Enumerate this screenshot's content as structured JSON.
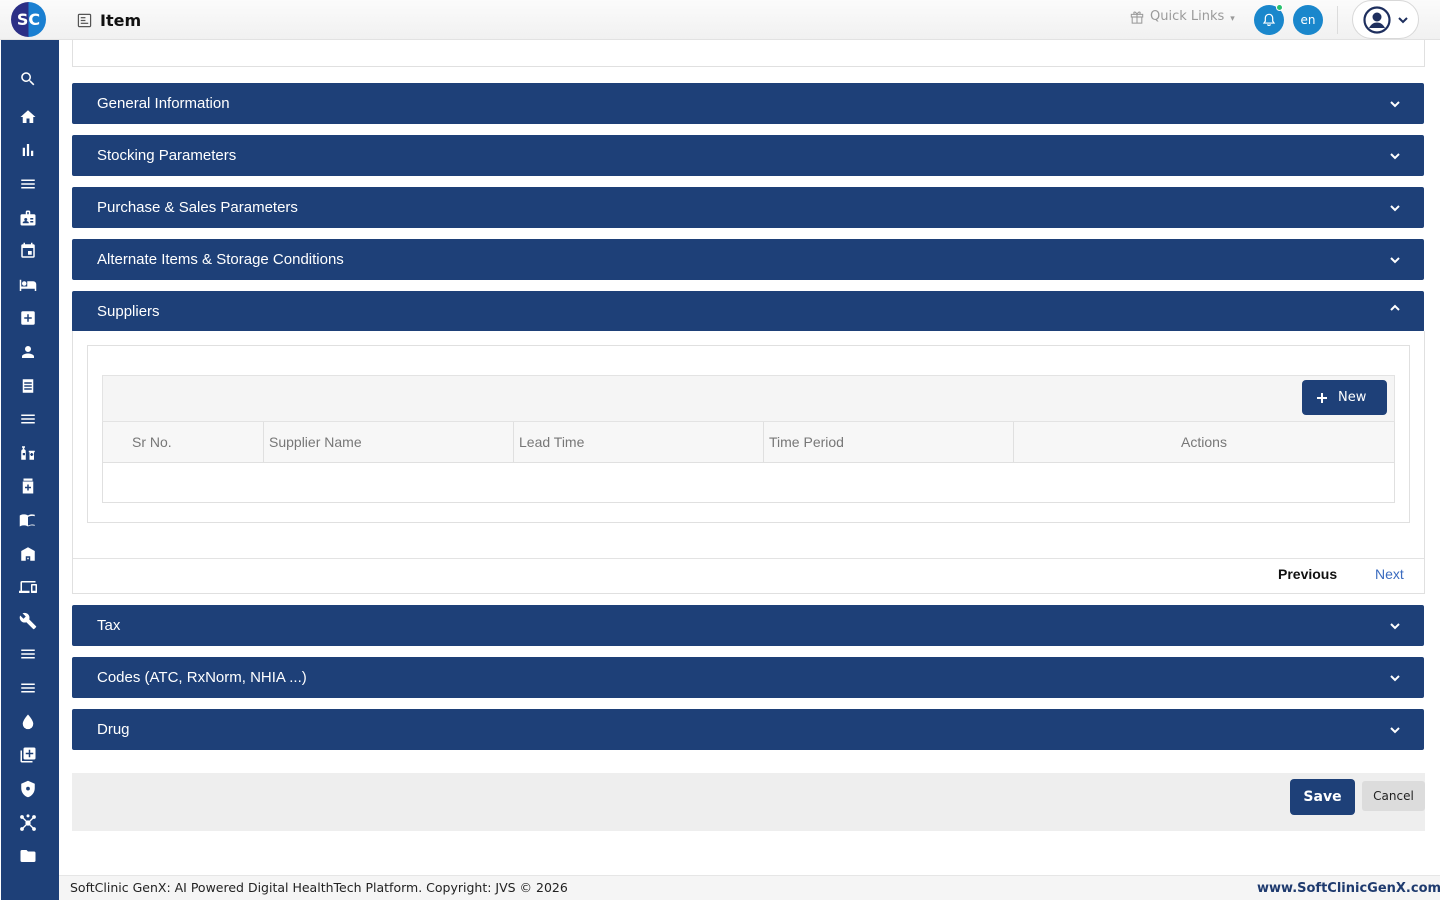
{
  "app": {
    "logo_text": "SC",
    "page_title": "Item"
  },
  "header": {
    "quick_links_label": "Quick Links",
    "language": "en",
    "accent_color": "#1a87cc"
  },
  "sidebar": {
    "items": [
      {
        "icon": "search-icon"
      },
      {
        "icon": "home-icon"
      },
      {
        "icon": "bar-chart-icon"
      },
      {
        "icon": "menu-icon"
      },
      {
        "icon": "id-badge-icon"
      },
      {
        "icon": "calendar-icon"
      },
      {
        "icon": "bed-icon"
      },
      {
        "icon": "medical-plus-icon"
      },
      {
        "icon": "person-icon"
      },
      {
        "icon": "document-list-icon"
      },
      {
        "icon": "menu-icon"
      },
      {
        "icon": "pharmacy-icon"
      },
      {
        "icon": "medicine-box-icon"
      },
      {
        "icon": "book-icon"
      },
      {
        "icon": "store-icon"
      },
      {
        "icon": "devices-icon"
      },
      {
        "icon": "wrench-icon"
      },
      {
        "icon": "menu-icon"
      },
      {
        "icon": "menu-icon"
      },
      {
        "icon": "blood-drop-icon"
      },
      {
        "icon": "add-box-icon"
      },
      {
        "icon": "shield-icon"
      },
      {
        "icon": "hub-icon"
      },
      {
        "icon": "folder-icon"
      }
    ]
  },
  "sections": {
    "general": "General Information",
    "stocking": "Stocking Parameters",
    "purchase_sales": "Purchase & Sales Parameters",
    "alternate": "Alternate Items & Storage Conditions",
    "suppliers": "Suppliers",
    "tax": "Tax",
    "codes": "Codes (ATC, RxNorm, NHIA ...)",
    "drug": "Drug"
  },
  "suppliers": {
    "new_button": "New",
    "columns": [
      "Sr No.",
      "Supplier Name",
      "Lead Time",
      "Time Period",
      "Actions"
    ],
    "rows": []
  },
  "pager": {
    "previous": "Previous",
    "next": "Next"
  },
  "actions": {
    "save": "Save",
    "cancel": "Cancel"
  },
  "footer": {
    "copyright": "SoftClinic GenX: AI Powered Digital HealthTech Platform. Copyright: JVS © 2026",
    "website": "www.SoftClinicGenX.com"
  },
  "colors": {
    "primary": "#1e4078",
    "link": "#3a6bbf"
  }
}
